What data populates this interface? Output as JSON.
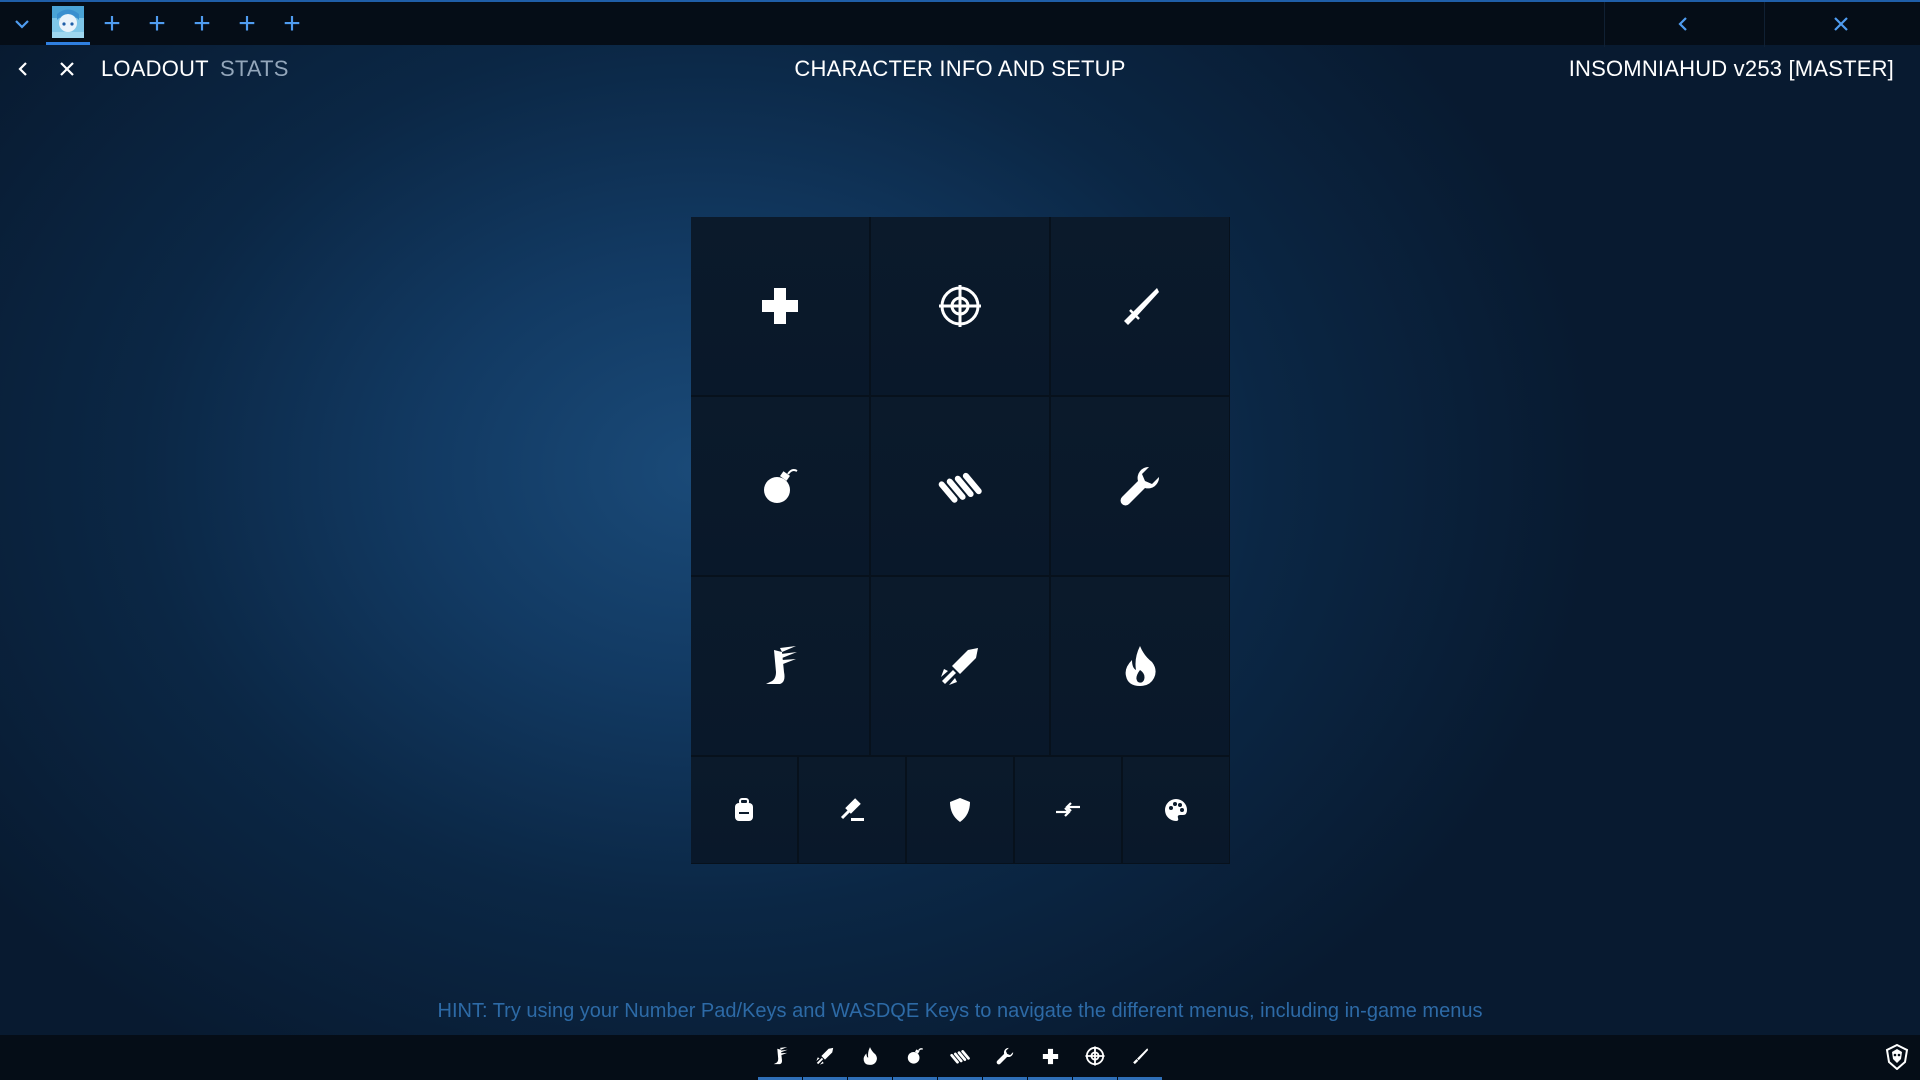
{
  "app": {
    "header": {
      "tabs": [
        {
          "label": "LOADOUT",
          "active": true
        },
        {
          "label": "STATS",
          "active": false
        }
      ],
      "title": "CHARACTER INFO AND SETUP",
      "version": "INSOMNIAHUD v253 [MASTER]"
    },
    "top_bar": {
      "icons": [
        "chevron-down-icon",
        "avatar",
        "plus-icon",
        "plus-icon",
        "plus-icon",
        "plus-icon",
        "plus-icon",
        "chevron-left-icon",
        "close-icon"
      ]
    },
    "grid": {
      "rows": [
        [
          "medkit-cross-icon",
          "crosshair-icon",
          "knife-icon"
        ],
        [
          "grenade-icon",
          "ammo-belt-icon",
          "wrench-icon"
        ],
        [
          "winged-boot-icon",
          "rocket-icon",
          "fire-icon"
        ]
      ],
      "bottom_row": [
        "backpack-icon",
        "gavel-icon",
        "shield-icon",
        "swap-arrows-icon",
        "palette-icon"
      ]
    },
    "hint": "HINT: Try using your Number Pad/Keys and WASDQE Keys to navigate the different menus, including in-game menus",
    "bottom_bar": {
      "icons": [
        "winged-boot-icon",
        "rocket-icon",
        "fire-icon",
        "grenade-icon",
        "ammo-belt-icon",
        "wrench-icon",
        "medkit-cross-icon",
        "crosshair-icon",
        "knife-icon"
      ],
      "corner_icon": "emblem-icon"
    },
    "colors": {
      "accent": "#4f9cf0",
      "background": "#0b2745",
      "panel": "#0b1a2b",
      "hint": "#2d6aa6"
    }
  }
}
